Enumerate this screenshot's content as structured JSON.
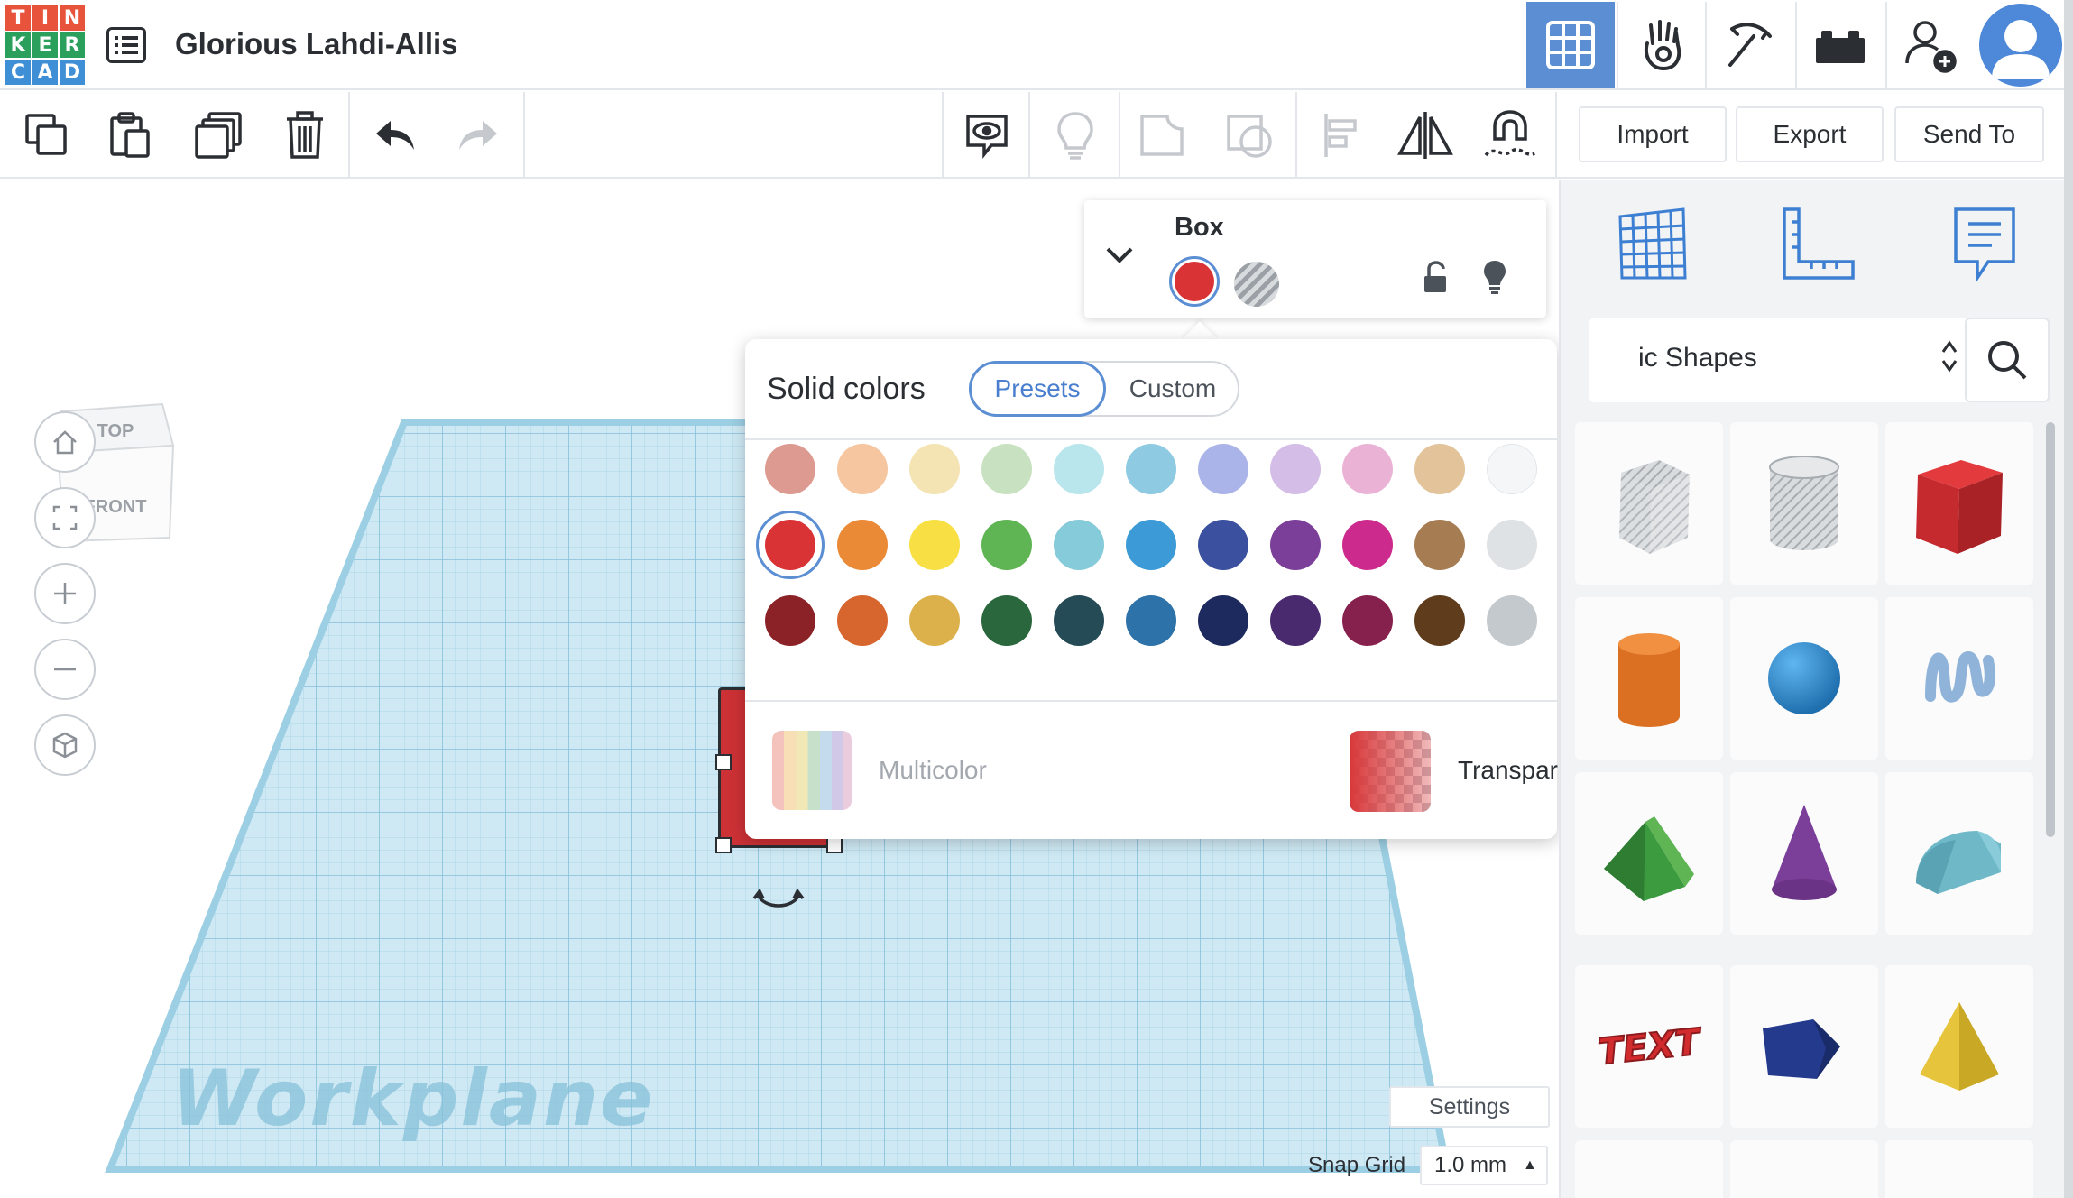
{
  "app": {
    "logo_letters": [
      "T",
      "I",
      "N",
      "K",
      "E",
      "R",
      "C",
      "A",
      "D"
    ],
    "logo_colors": [
      "#e8543b",
      "#e8543b",
      "#e8543b",
      "#2aa05c",
      "#2aa05c",
      "#2aa05c",
      "#3e8fd6",
      "#3e8fd6",
      "#3e8fd6"
    ],
    "design_title": "Glorious Lahdi-Allis",
    "accent": "#5b8ed3"
  },
  "nav": [
    {
      "name": "3d-design-grid-icon",
      "active": true
    },
    {
      "name": "circuits-hand-icon",
      "active": false
    },
    {
      "name": "codeblocks-pickaxe-icon",
      "active": false
    },
    {
      "name": "bricks-icon",
      "active": false
    },
    {
      "name": "add-user-icon",
      "active": false
    },
    {
      "name": "user-avatar",
      "active": false
    }
  ],
  "toolbar": {
    "left_tools": [
      "copy-icon",
      "paste-icon",
      "duplicate-icon",
      "delete-icon",
      "undo-icon",
      "redo-icon"
    ],
    "right_tools": [
      "notes-icon",
      "show-all-icon",
      "group-icon",
      "ungroup-icon",
      "align-icon",
      "mirror-icon",
      "cruise-magnet-icon"
    ],
    "import_label": "Import",
    "export_label": "Export",
    "send_to_label": "Send To"
  },
  "viewcube": {
    "top_label": "TOP",
    "front_label": "FRONT"
  },
  "workspace": {
    "workplane_label": "Workplane",
    "settings_label": "Settings",
    "snap_grid_label": "Snap Grid",
    "snap_grid_value": "1.0 mm"
  },
  "inspector": {
    "shape_name": "Box",
    "solid_color": "#d93336"
  },
  "color_popup": {
    "title": "Solid colors",
    "tab_presets": "Presets",
    "tab_custom": "Custom",
    "active_tab": "Presets",
    "selected_color": "#d93336",
    "rows": [
      [
        "#dd9a90",
        "#f5c6a0",
        "#f4e4b4",
        "#c8e1c0",
        "#b9e6ed",
        "#8fcae3",
        "#aab4e9",
        "#d4bde6",
        "#eab3d6",
        "#e2c39a",
        "#f5f6f7",
        "#a7abaf"
      ],
      [
        "#d93336",
        "#ea8a36",
        "#f7df44",
        "#5fb454",
        "#86cbd9",
        "#3c9bd6",
        "#3b509e",
        "#7b3f9a",
        "#cc2a8c",
        "#a67c52",
        "#dfe2e5",
        "#5d6266"
      ],
      [
        "#8b2227",
        "#d6662e",
        "#dcb04a",
        "#2a673c",
        "#254b57",
        "#2d72a8",
        "#1d2a5e",
        "#4a2a6e",
        "#86204c",
        "#5f3c1c",
        "#c4c9cd",
        "#2b2d30"
      ]
    ],
    "multicolor_label": "Multicolor",
    "transparent_label": "Transparent"
  },
  "panel": {
    "tabs": [
      "grid-icon",
      "ruler-icon",
      "notes-icon"
    ],
    "category_label": "ic Shapes",
    "shapes": [
      "box-hole-shape",
      "cylinder-hole-shape",
      "box-shape",
      "cylinder-shape",
      "sphere-shape",
      "scribble-shape",
      "roof-shape",
      "cone-shape",
      "round-roof-shape",
      "text-shape",
      "polygon-shape",
      "pyramid-shape"
    ]
  }
}
